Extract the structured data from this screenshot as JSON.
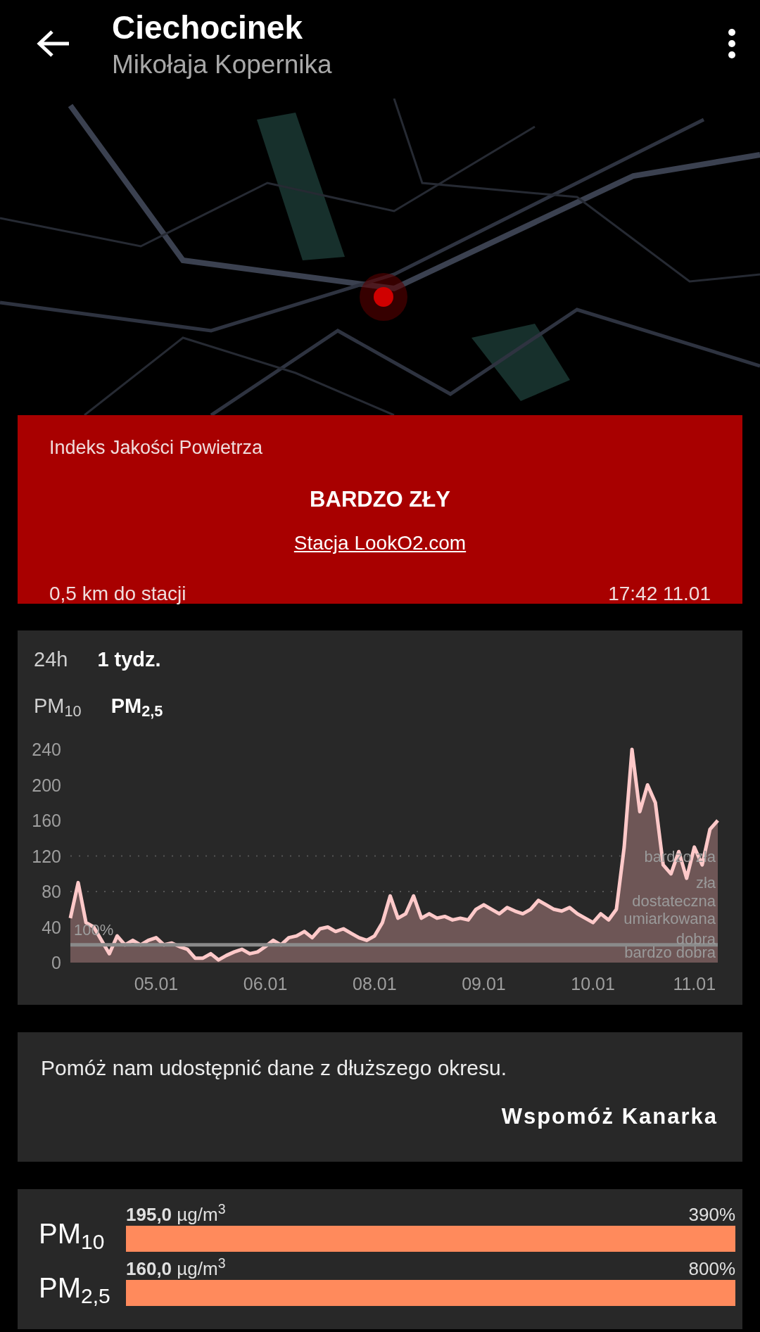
{
  "header": {
    "title": "Ciechocinek",
    "subtitle": "Mikołaja Kopernika"
  },
  "index_card": {
    "label": "Indeks Jakości Powietrza",
    "rating": "BARDZO ZŁY",
    "station_link": "Stacja LookO2.com",
    "distance": "0,5 km do stacji",
    "time": "17:42 11.01"
  },
  "range_tabs": [
    {
      "label": "24h",
      "selected": false
    },
    {
      "label": "1 tydz.",
      "selected": true
    }
  ],
  "pollutant_tabs": [
    {
      "label": "PM$_{10}$",
      "selected": false
    },
    {
      "label": "PM$_{2,5}$",
      "selected": true
    }
  ],
  "chart": {
    "chart_data": {
      "type": "area",
      "categories": [
        null,
        null,
        null,
        null,
        null,
        null,
        null,
        null,
        null,
        null,
        null,
        "05.01",
        null,
        null,
        null,
        null,
        null,
        null,
        null,
        null,
        null,
        null,
        null,
        null,
        null,
        "06.01",
        null,
        null,
        null,
        null,
        null,
        null,
        null,
        null,
        null,
        null,
        null,
        null,
        null,
        "08.01",
        null,
        null,
        null,
        null,
        null,
        null,
        null,
        null,
        null,
        null,
        null,
        null,
        null,
        "09.01",
        null,
        null,
        null,
        null,
        null,
        null,
        null,
        null,
        null,
        null,
        null,
        null,
        null,
        "10.01",
        null,
        null,
        null,
        null,
        null,
        null,
        null,
        null,
        null,
        null,
        null,
        null,
        "11.01",
        null,
        null,
        null
      ],
      "series": [
        {
          "color": "#ffc9c9",
          "values": [
            50,
            90,
            45,
            40,
            25,
            10,
            30,
            20,
            25,
            20,
            25,
            28,
            20,
            22,
            18,
            15,
            5,
            5,
            10,
            3,
            8,
            12,
            15,
            10,
            12,
            18,
            25,
            20,
            28,
            30,
            35,
            28,
            38,
            40,
            35,
            38,
            33,
            28,
            25,
            30,
            45,
            75,
            50,
            55,
            75,
            50,
            55,
            50,
            52,
            48,
            50,
            48,
            60,
            65,
            60,
            55,
            62,
            58,
            55,
            60,
            70,
            65,
            60,
            58,
            62,
            55,
            50,
            45,
            55,
            48,
            60,
            130,
            240,
            170,
            200,
            180,
            110,
            100,
            125,
            95,
            130,
            110,
            150,
            160
          ]
        }
      ],
      "ylim": [
        0,
        240
      ],
      "yticks": [
        0,
        40,
        80,
        120,
        160,
        200,
        240
      ],
      "annotations": [
        "100%",
        "bardzo zła",
        "zła",
        "dostateczna",
        "umiarkowana",
        "dobra",
        "bardzo dobra"
      ]
    }
  },
  "support": {
    "message": "Pomóż nam udostępnić dane z dłuższego okresu.",
    "button": "Wspomóż Kanarka"
  },
  "measurements": [
    {
      "name": "PM$_{10}$",
      "value": "**195,0** µg/m$^{3}$",
      "percent": "390%"
    },
    {
      "name": "PM$_{2,5}$",
      "value": "**160,0** µg/m$^{3}$",
      "percent": "800%"
    }
  ]
}
